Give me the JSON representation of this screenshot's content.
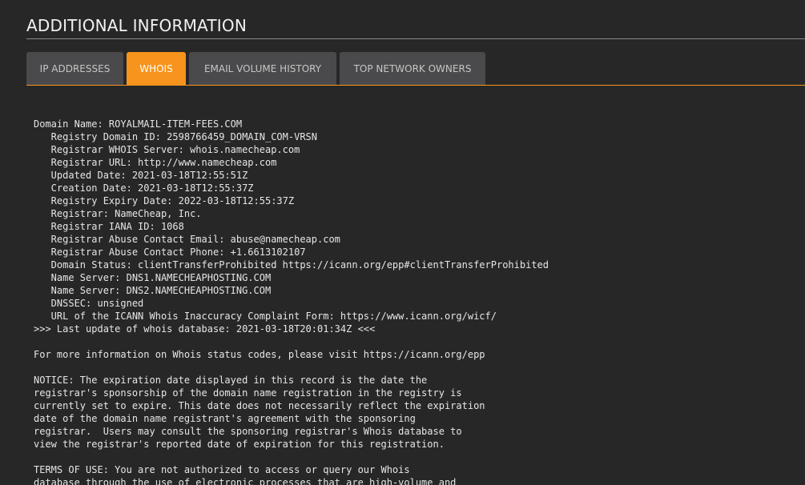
{
  "section": {
    "title": "ADDITIONAL INFORMATION"
  },
  "tabs": [
    {
      "label": "IP ADDRESSES",
      "active": false
    },
    {
      "label": "WHOIS",
      "active": true
    },
    {
      "label": "EMAIL VOLUME HISTORY",
      "active": false
    },
    {
      "label": "TOP NETWORK OWNERS",
      "active": false
    }
  ],
  "colors": {
    "accent": "#f7941d",
    "background": "#272727",
    "tab_inactive": "#4a4a4c"
  },
  "whois": {
    "text": "Domain Name: ROYALMAIL-ITEM-FEES.COM\n   Registry Domain ID: 2598766459_DOMAIN_COM-VRSN\n   Registrar WHOIS Server: whois.namecheap.com\n   Registrar URL: http://www.namecheap.com\n   Updated Date: 2021-03-18T12:55:51Z\n   Creation Date: 2021-03-18T12:55:37Z\n   Registry Expiry Date: 2022-03-18T12:55:37Z\n   Registrar: NameCheap, Inc.\n   Registrar IANA ID: 1068\n   Registrar Abuse Contact Email: abuse@namecheap.com\n   Registrar Abuse Contact Phone: +1.6613102107\n   Domain Status: clientTransferProhibited https://icann.org/epp#clientTransferProhibited\n   Name Server: DNS1.NAMECHEAPHOSTING.COM\n   Name Server: DNS2.NAMECHEAPHOSTING.COM\n   DNSSEC: unsigned\n   URL of the ICANN Whois Inaccuracy Complaint Form: https://www.icann.org/wicf/\n>>> Last update of whois database: 2021-03-18T20:01:34Z <<<\n\nFor more information on Whois status codes, please visit https://icann.org/epp\n\nNOTICE: The expiration date displayed in this record is the date the\nregistrar's sponsorship of the domain name registration in the registry is\ncurrently set to expire. This date does not necessarily reflect the expiration\ndate of the domain name registrant's agreement with the sponsoring\nregistrar.  Users may consult the sponsoring registrar's Whois database to\nview the registrar's reported date of expiration for this registration.\n\nTERMS OF USE: You are not authorized to access or query our Whois\ndatabase through the use of electronic processes that are high-volume and"
  }
}
